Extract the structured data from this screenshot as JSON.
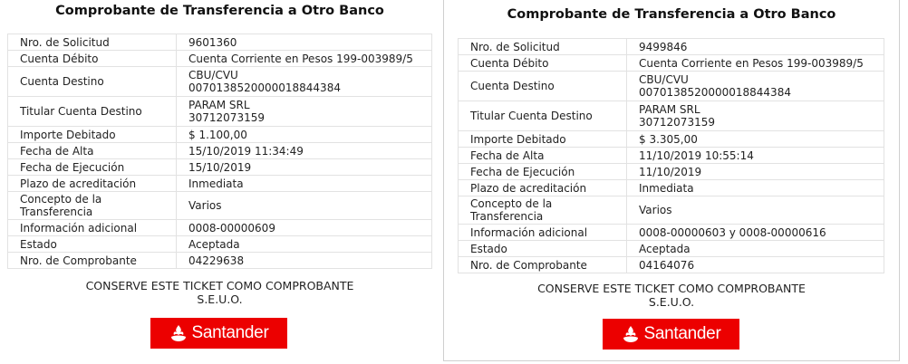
{
  "left": {
    "title": "Comprobante de Transferencia a Otro Banco",
    "rows": [
      {
        "label": "Nro. de Solicitud",
        "value": "9601360"
      },
      {
        "label": "Cuenta Débito",
        "value": "Cuenta Corriente en Pesos 199-003989/5"
      },
      {
        "label": "Cuenta Destino",
        "value": "CBU/CVU",
        "value2": "0070138520000018844384"
      },
      {
        "label": "Titular Cuenta Destino",
        "value": "PARAM SRL",
        "value2": "30712073159"
      },
      {
        "label": "Importe Debitado",
        "value": "$ 1.100,00"
      },
      {
        "label": "Fecha de Alta",
        "value": "15/10/2019 11:34:49"
      },
      {
        "label": "Fecha de Ejecución",
        "value": "15/10/2019"
      },
      {
        "label": "Plazo de acreditación",
        "value": "Inmediata"
      },
      {
        "label": "Concepto de la Transferencia",
        "value": "Varios"
      },
      {
        "label": "Información adicional",
        "value": "0008-00000609"
      },
      {
        "label": "Estado",
        "value": "Aceptada"
      },
      {
        "label": "Nro. de Comprobante",
        "value": "04229638"
      }
    ],
    "footer_line1": "CONSERVE ESTE TICKET COMO COMPROBANTE",
    "footer_line2": "S.E.U.O.",
    "logo_text": "Santander"
  },
  "right": {
    "title": "Comprobante de Transferencia a Otro Banco",
    "rows": [
      {
        "label": "Nro. de Solicitud",
        "value": "9499846"
      },
      {
        "label": "Cuenta Débito",
        "value": "Cuenta Corriente en Pesos 199-003989/5"
      },
      {
        "label": "Cuenta Destino",
        "value": "CBU/CVU",
        "value2": "0070138520000018844384"
      },
      {
        "label": "Titular Cuenta Destino",
        "value": "PARAM SRL",
        "value2": "30712073159"
      },
      {
        "label": "Importe Debitado",
        "value": "$ 3.305,00"
      },
      {
        "label": "Fecha de Alta",
        "value": "11/10/2019 10:55:14"
      },
      {
        "label": "Fecha de Ejecución",
        "value": "11/10/2019"
      },
      {
        "label": "Plazo de acreditación",
        "value": "Inmediata"
      },
      {
        "label": "Concepto de la Transferencia",
        "value": "Varios"
      },
      {
        "label": "Información adicional",
        "value": "0008-00000603 y 0008-00000616"
      },
      {
        "label": "Estado",
        "value": "Aceptada"
      },
      {
        "label": "Nro. de Comprobante",
        "value": "04164076"
      }
    ],
    "footer_line1": "CONSERVE ESTE TICKET COMO COMPROBANTE",
    "footer_line2": "S.E.U.O.",
    "logo_text": "Santander"
  },
  "colors": {
    "brand_red": "#ec0000",
    "border": "#e2e2e2"
  },
  "icons": {
    "logo": "santander-flame-icon"
  }
}
